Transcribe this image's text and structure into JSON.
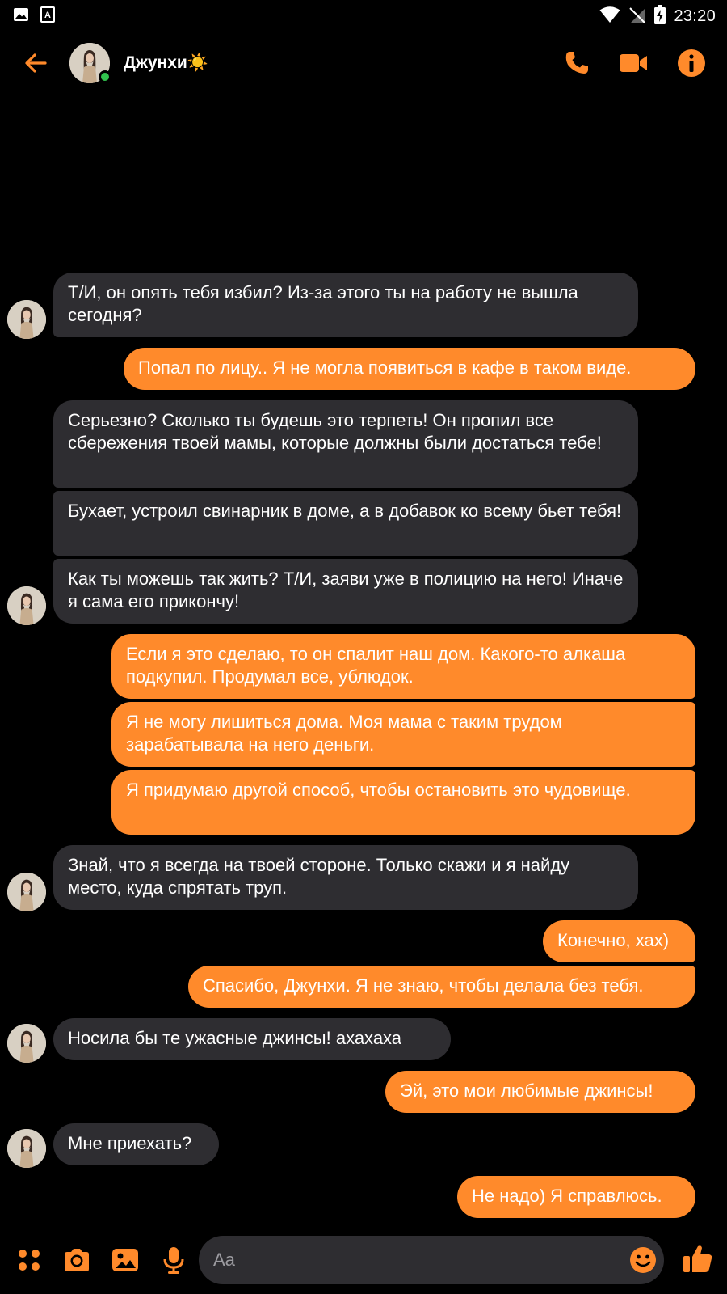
{
  "status_bar": {
    "time": "23:20",
    "icons": [
      "image-icon",
      "font-a-icon",
      "wifi-icon",
      "no-sim-icon",
      "battery-charging-icon"
    ]
  },
  "header": {
    "contact_name": "Джунхи☀️",
    "online": true,
    "accent_color": "#ff8a2b",
    "icons": [
      "back-arrow-icon",
      "phone-icon",
      "video-camera-icon",
      "info-icon"
    ]
  },
  "messages": [
    {
      "dir": "in",
      "text": "Т/И, он опять тебя избил? Из-за этого ты на работу не вышла сегодня?"
    },
    {
      "dir": "out",
      "text": "Попал по лицу.. Я не могла появиться в кафе в таком виде."
    },
    {
      "dir": "in",
      "text": "Серьезно? Сколько ты будешь это терпеть! Он пропил все сбережения твоей мамы, которые должны были достаться тебе!"
    },
    {
      "dir": "in",
      "text": "Бухает, устроил свинарник в доме, а в добавок ко всему бьет тебя!"
    },
    {
      "dir": "in",
      "text": "Как ты можешь так жить? Т/И, заяви уже в полицию на него! Иначе я сама его прикончу!"
    },
    {
      "dir": "out",
      "text": "Если я это сделаю, то он спалит наш дом. Какого-то алкаша подкупил. Продумал все, ублюдок."
    },
    {
      "dir": "out",
      "text": "Я не могу лишиться дома. Моя мама с таким трудом зарабатывала на него деньги."
    },
    {
      "dir": "out",
      "text": "Я придумаю другой способ, чтобы остановить это чудовище."
    },
    {
      "dir": "in",
      "text": "Знай, что я всегда на твоей стороне. Только скажи и я найду место, куда спрятать труп."
    },
    {
      "dir": "out",
      "text": "Конечно, хах)"
    },
    {
      "dir": "out",
      "text": "Спасибо, Джунхи. Я не знаю, чтобы делала без тебя."
    },
    {
      "dir": "in",
      "text": "Носила бы те ужасные джинсы! ахахаха"
    },
    {
      "dir": "out",
      "text": "Эй, это мои любимые джинсы!"
    },
    {
      "dir": "in",
      "text": "Мне приехать?"
    },
    {
      "dir": "out",
      "text": "Не надо) Я справлюсь."
    }
  ],
  "composer": {
    "placeholder": "Aa",
    "icons": [
      "apps-grid-icon",
      "camera-icon",
      "gallery-icon",
      "microphone-icon",
      "emoji-icon",
      "thumbs-up-icon"
    ]
  }
}
